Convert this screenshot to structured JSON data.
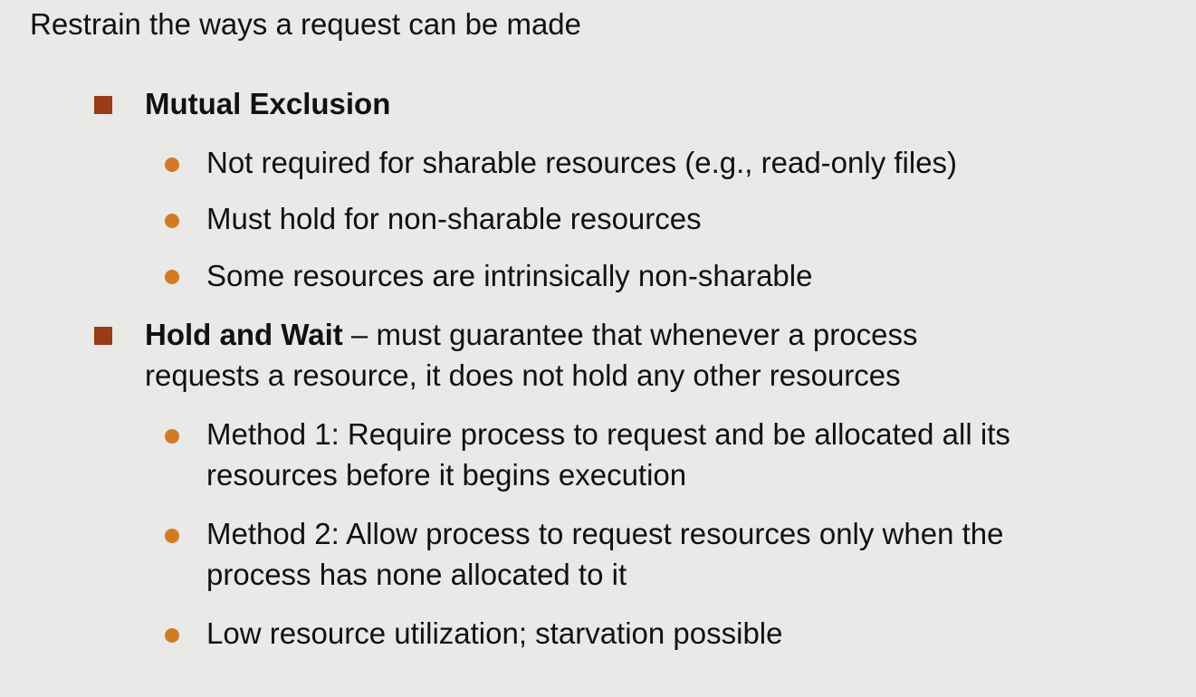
{
  "title": "Restrain the ways a request can be made",
  "colors": {
    "square_bullet": "#9b3b16",
    "round_bullet": "#d27b22",
    "background": "#e9e9e7"
  },
  "items": [
    {
      "heading": "Mutual Exclusion",
      "rest": "",
      "subitems": [
        {
          "lines": [
            "Not required for sharable resources (e.g., read-only files)"
          ]
        },
        {
          "lines": [
            "Must hold for non-sharable resources"
          ]
        },
        {
          "lines": [
            "Some resources are intrinsically non-sharable"
          ]
        }
      ]
    },
    {
      "heading": "Hold and Wait",
      "rest": " – must guarantee that whenever a process",
      "line2": "requests a resource, it does not hold any other resources",
      "subitems": [
        {
          "lines": [
            "Method 1: Require process to request and be allocated all its",
            "resources before it begins execution"
          ]
        },
        {
          "lines": [
            "Method 2: Allow process to request resources only when the",
            "process has none allocated to it"
          ]
        },
        {
          "lines": [
            "Low resource utilization; starvation possible"
          ]
        }
      ]
    }
  ]
}
